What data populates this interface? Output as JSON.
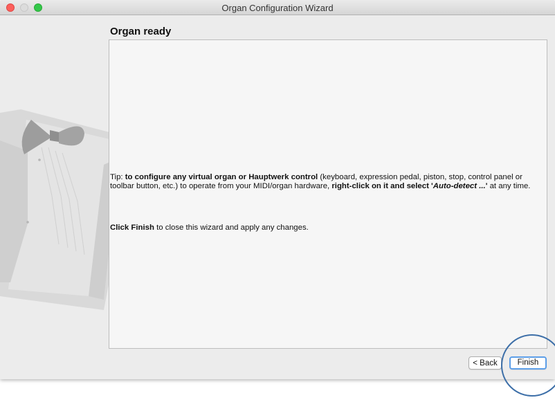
{
  "window": {
    "title": "Organ Configuration Wizard"
  },
  "page": {
    "heading": "Organ ready"
  },
  "tip": {
    "prefix": "Tip: ",
    "bold1": "to configure any virtual organ or Hauptwerk control",
    "text1": " (keyboard, expression pedal, piston, stop, control panel or toolbar button, etc.) to operate from your MIDI/organ hardware, ",
    "bold2": "right-click on it and select '",
    "bold_italic": "Auto-detect ...",
    "bold3": "'",
    "text2": " at any time."
  },
  "finish_note": {
    "bold": "Click Finish",
    "text": " to close this wizard and apply any changes."
  },
  "buttons": {
    "back": "< Back",
    "finish": "Finish"
  },
  "colors": {
    "annotation_circle": "#3d6fa8",
    "focus_ring": "#5c9ee8",
    "close": "#fc605c",
    "maximize": "#34c84a"
  },
  "icons": {
    "side_art": "tuxedo-icon"
  }
}
